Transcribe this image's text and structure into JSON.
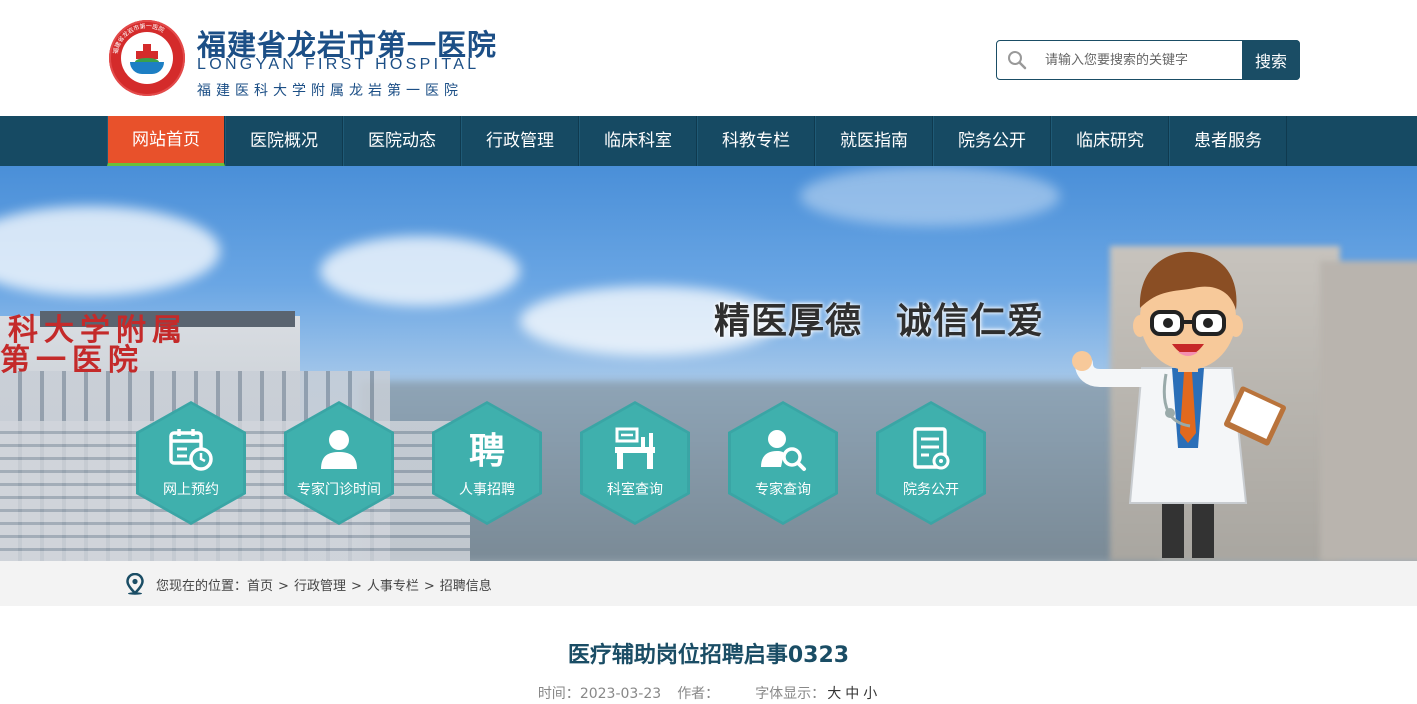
{
  "header": {
    "title_cn": "福建省龙岩市第一医院",
    "title_en": "LONGYAN FIRST HOSPITAL",
    "subtitle": "福建医科大学附属龙岩第一医院",
    "logo_ring_text": "福建省龙岩市第一医院",
    "logo_ring_en": "LONGYAN FIRST HOSPITAL",
    "logo_year": "1919"
  },
  "search": {
    "placeholder": "请输入您要搜索的关键字",
    "button_label": "搜索"
  },
  "nav": {
    "items": [
      {
        "label": "网站首页",
        "active": true
      },
      {
        "label": "医院概况"
      },
      {
        "label": "医院动态"
      },
      {
        "label": "行政管理"
      },
      {
        "label": "临床科室"
      },
      {
        "label": "科教专栏"
      },
      {
        "label": "就医指南"
      },
      {
        "label": "院务公开"
      },
      {
        "label": "临床研究"
      },
      {
        "label": "患者服务"
      }
    ]
  },
  "banner": {
    "slogan_1": "精医厚德",
    "slogan_2": "诚信仁爱",
    "building_sign_1": "科大学附属",
    "building_sign_2": "第一医院",
    "quick_links": [
      {
        "label": "网上预约",
        "icon": "calendar-clock-icon"
      },
      {
        "label": "专家门诊时间",
        "icon": "person-icon"
      },
      {
        "label": "人事招聘",
        "icon": "recruit-icon"
      },
      {
        "label": "科室查询",
        "icon": "department-icon"
      },
      {
        "label": "专家查询",
        "icon": "expert-search-icon"
      },
      {
        "label": "院务公开",
        "icon": "document-icon"
      }
    ]
  },
  "breadcrumb": {
    "prefix": "您现在的位置：",
    "items": [
      "首页",
      "行政管理",
      "人事专栏",
      "招聘信息"
    ],
    "separator": ">"
  },
  "article": {
    "title": "医疗辅助岗位招聘启事0323",
    "time_label": "时间：",
    "time_value": "2023-03-23",
    "author_label": "作者：",
    "font_label": "字体显示：",
    "font_large": "大",
    "font_medium": "中",
    "font_small": "小"
  },
  "colors": {
    "primary": "#164a63",
    "active_nav": "#e8512b",
    "hex": "#3fb0ad",
    "title": "#1a4d65"
  }
}
